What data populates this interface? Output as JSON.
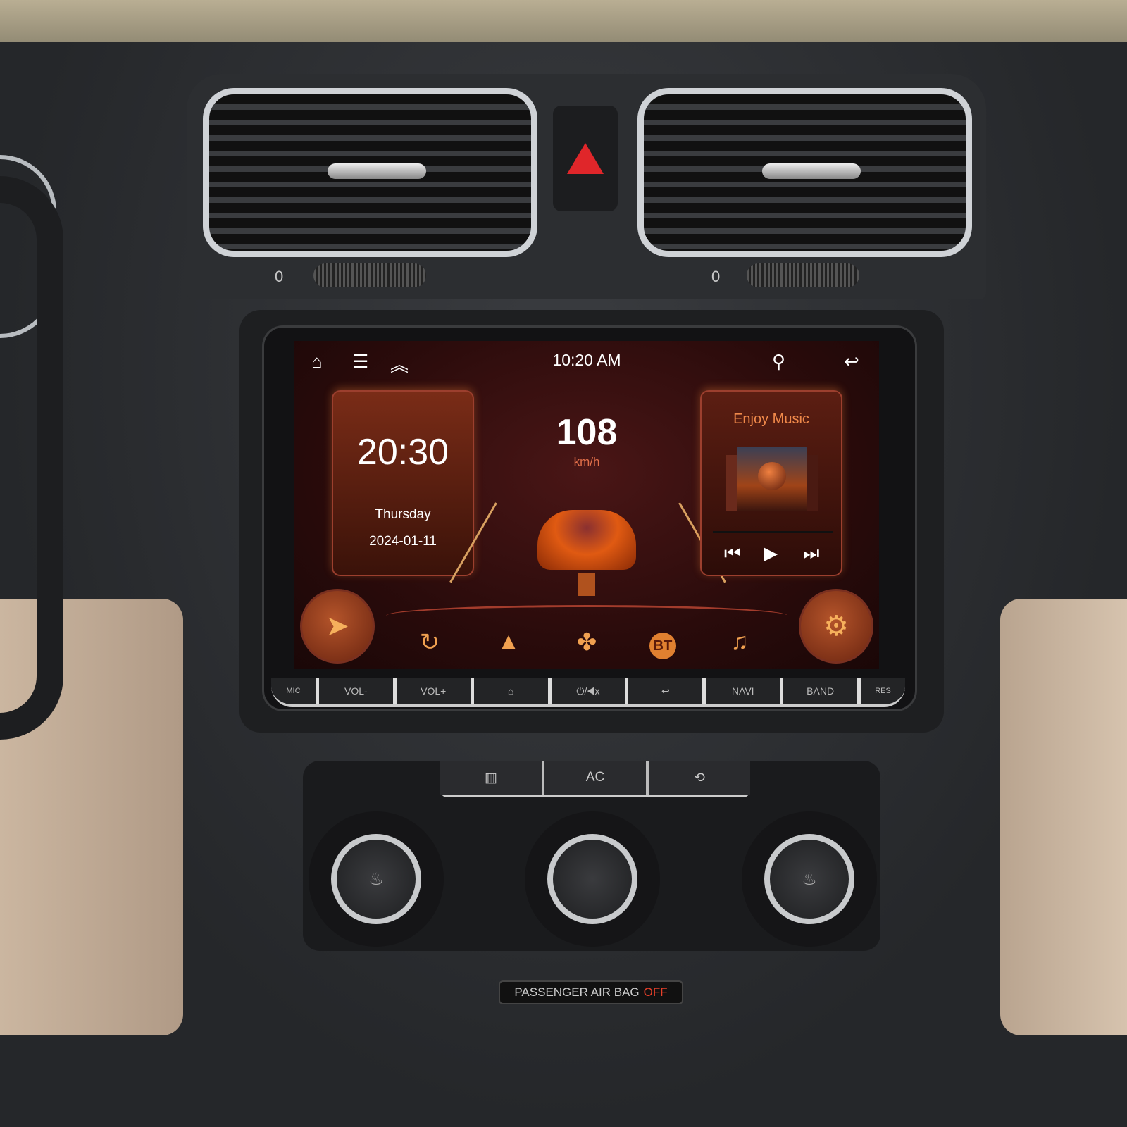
{
  "status_bar": {
    "time": "10:20 AM",
    "icons": [
      "home-icon",
      "menu-icon",
      "double-chevron-up-icon",
      "location-pin-icon",
      "back-icon"
    ]
  },
  "clock_card": {
    "time": "20:30",
    "day": "Thursday",
    "date": "2024-01-11"
  },
  "speed": {
    "value": "108",
    "unit": "km/h"
  },
  "music_card": {
    "title": "Enjoy Music",
    "controls": [
      "previous-icon",
      "play-icon",
      "next-icon"
    ]
  },
  "dock": {
    "items": [
      "navigation-icon",
      "carplay-icon",
      "android-auto-icon",
      "apps-icon",
      "BT",
      "music-note-icon",
      "settings-icon"
    ],
    "bt_label": "BT"
  },
  "hard_keys": [
    "MIC",
    "VOL-",
    "VOL+",
    "⌂",
    "⏻/◀x",
    "↩",
    "NAVI",
    "BAND",
    "RES"
  ],
  "vents": {
    "left_label": "0",
    "right_label": "0"
  },
  "climate": {
    "buttons": [
      "rear-defrost-icon",
      "AC",
      "recirculation-icon"
    ],
    "ac_label": "AC"
  },
  "airbag": {
    "text": "PASSENGER AIR BAG",
    "status": "OFF"
  },
  "colors": {
    "accent": "#f0894a",
    "screen_bg": "#2a0b0b",
    "hazard": "#e0262a"
  }
}
